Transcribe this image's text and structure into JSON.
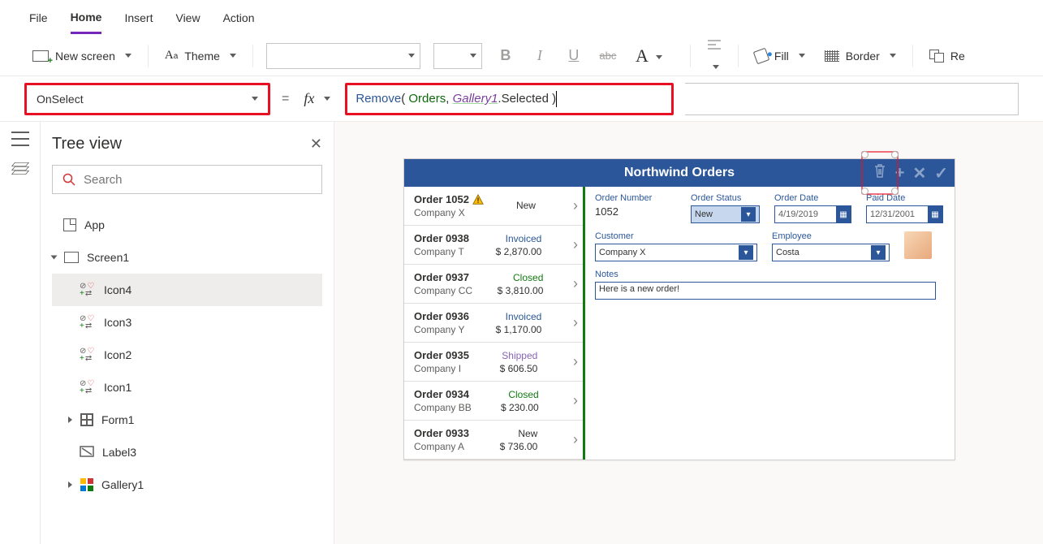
{
  "menu": {
    "items": [
      "File",
      "Home",
      "Insert",
      "View",
      "Action"
    ],
    "active": "Home"
  },
  "ribbon": {
    "new_screen": "New screen",
    "theme": "Theme",
    "fill": "Fill",
    "border": "Border",
    "re": "Re"
  },
  "prop": {
    "selected": "OnSelect",
    "formula_fn": "Remove",
    "formula_arg1": "Orders",
    "formula_arg2": "Gallery1",
    "formula_tail": ".Selected"
  },
  "tree": {
    "title": "Tree view",
    "search_placeholder": "Search",
    "nodes": {
      "app": "App",
      "screen1": "Screen1",
      "icon4": "Icon4",
      "icon3": "Icon3",
      "icon2": "Icon2",
      "icon1": "Icon1",
      "form1": "Form1",
      "label3": "Label3",
      "gallery1": "Gallery1"
    }
  },
  "app": {
    "title": "Northwind Orders",
    "gallery": [
      {
        "order": "Order 1052",
        "company": "Company X",
        "status": "New",
        "amount": "",
        "warn": true
      },
      {
        "order": "Order 0938",
        "company": "Company T",
        "status": "Invoiced",
        "amount": "$ 2,870.00"
      },
      {
        "order": "Order 0937",
        "company": "Company CC",
        "status": "Closed",
        "amount": "$ 3,810.00"
      },
      {
        "order": "Order 0936",
        "company": "Company Y",
        "status": "Invoiced",
        "amount": "$ 1,170.00"
      },
      {
        "order": "Order 0935",
        "company": "Company I",
        "status": "Shipped",
        "amount": "$ 606.50"
      },
      {
        "order": "Order 0934",
        "company": "Company BB",
        "status": "Closed",
        "amount": "$ 230.00"
      },
      {
        "order": "Order 0933",
        "company": "Company A",
        "status": "New",
        "amount": "$ 736.00"
      }
    ],
    "detail": {
      "labels": {
        "order_number": "Order Number",
        "order_status": "Order Status",
        "order_date": "Order Date",
        "paid_date": "Paid Date",
        "customer": "Customer",
        "employee": "Employee",
        "notes": "Notes"
      },
      "order_number": "1052",
      "order_status": "New",
      "order_date": "4/19/2019",
      "paid_date": "12/31/2001",
      "customer": "Company X",
      "employee": "Costa",
      "notes": "Here is a new order!"
    }
  }
}
